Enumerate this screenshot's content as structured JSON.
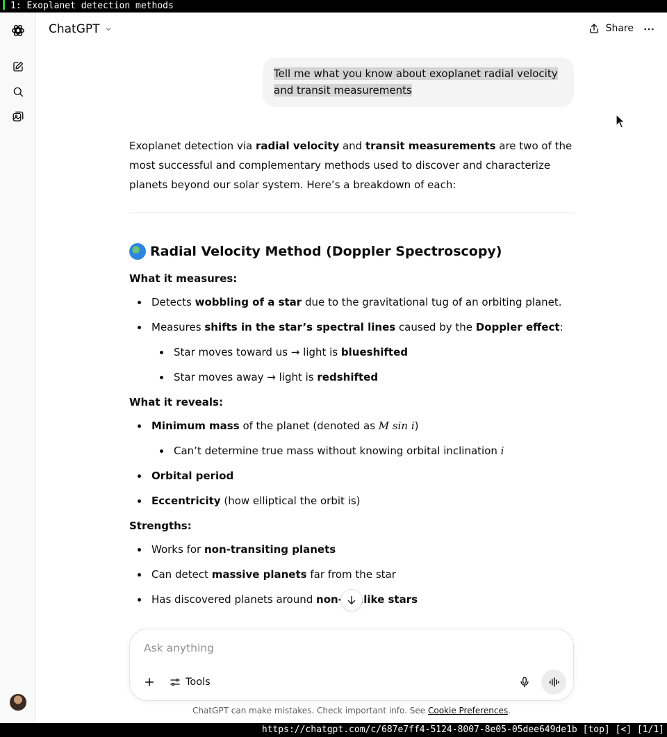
{
  "terminal": {
    "tab_title": "1: Exoplanet detection methods",
    "status_url": "https://chatgpt.com/c/687e7ff4-5124-8007-8e05-05dee649de1b [top] [<] [1/1]"
  },
  "header": {
    "model": "ChatGPT",
    "share_label": "Share"
  },
  "user_message": "Tell me what you know about exoplanet radial velocity and transit measurements",
  "response": {
    "intro_pre": "Exoplanet detection via ",
    "intro_b1": "radial velocity",
    "intro_mid": " and ",
    "intro_b2": "transit measurements",
    "intro_post": " are two of the most successful and complementary methods used to discover and characterize planets beyond our solar system. Here’s a breakdown of each:",
    "section_title": "Radial Velocity Method (Doppler Spectroscopy)",
    "measures_heading": "What it measures:",
    "m1_pre": "Detects ",
    "m1_b": "wobbling of a star",
    "m1_post": " due to the gravitational tug of an orbiting planet.",
    "m2_pre": "Measures ",
    "m2_b": "shifts in the star’s spectral lines",
    "m2_mid": " caused by the ",
    "m2_b2": "Doppler effect",
    "m2_post": ":",
    "n1_pre": "Star moves toward us → light is ",
    "n1_b": "blueshifted",
    "n2_pre": "Star moves away → light is ",
    "n2_b": "redshifted",
    "reveals_heading": "What it reveals:",
    "r1_b": "Minimum mass",
    "r1_pre": " of the planet (denoted as ",
    "r1_math": "M sin i",
    "r1_post": ")",
    "rn1_text": "Can’t determine true mass without knowing orbital inclination ",
    "rn1_math": "i",
    "r2_b": "Orbital period",
    "r3_b": "Eccentricity",
    "r3_post": " (how elliptical the orbit is)",
    "strengths_heading": "Strengths:",
    "s1_pre": "Works for ",
    "s1_b": "non-transiting planets",
    "s2_pre": "Can detect ",
    "s2_b": "massive planets",
    "s2_post": " far from the star",
    "s3_pre": "Has discovered planets around ",
    "s3_b": "non-sunlike stars"
  },
  "composer": {
    "placeholder": "Ask anything",
    "tools_label": "Tools"
  },
  "disclaimer": {
    "text": "ChatGPT can make mistakes. Check important info. See ",
    "link": "Cookie Preferences",
    "end": "."
  }
}
